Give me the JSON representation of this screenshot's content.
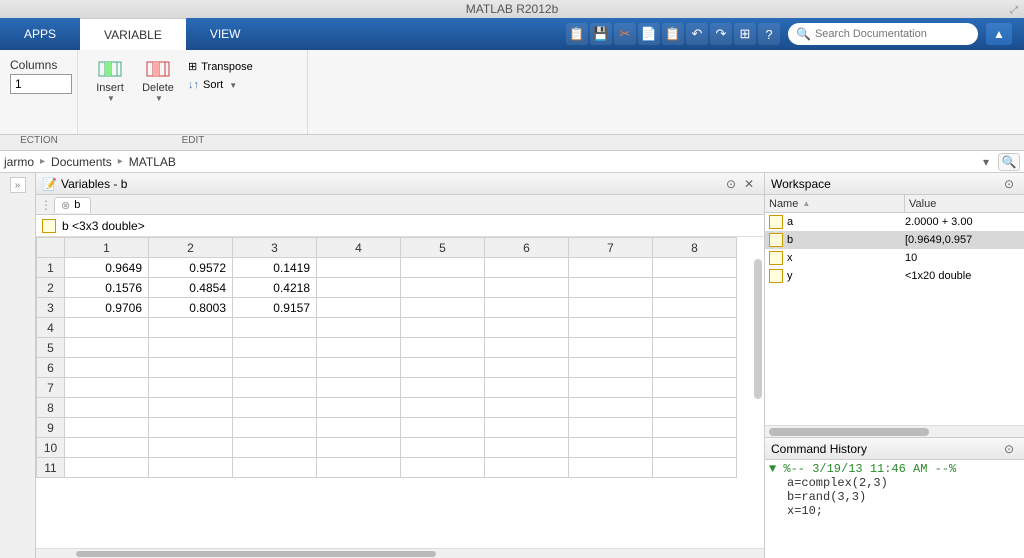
{
  "app": {
    "title": "MATLAB R2012b"
  },
  "ribbon": {
    "tabs": {
      "apps": "APPS",
      "variable": "VARIABLE",
      "view": "VIEW"
    },
    "columns_label": "Columns",
    "columns_value": "1",
    "insert": "Insert",
    "delete": "Delete",
    "transpose": "Transpose",
    "sort": "Sort",
    "group_selection": "ECTION",
    "group_edit": "EDIT"
  },
  "search": {
    "placeholder": "Search Documentation"
  },
  "path": {
    "seg1": "jarmo",
    "seg2": "Documents",
    "seg3": "MATLAB"
  },
  "variables_panel": {
    "title": "Variables - b",
    "tab_name": "b",
    "info": "b <3x3 double>",
    "col_heads": [
      "1",
      "2",
      "3",
      "4",
      "5",
      "6",
      "7",
      "8"
    ],
    "row_heads": [
      "1",
      "2",
      "3",
      "4",
      "5",
      "6",
      "7",
      "8",
      "9",
      "10",
      "11"
    ],
    "cells": [
      [
        "0.9649",
        "0.9572",
        "0.1419",
        "",
        "",
        "",
        "",
        ""
      ],
      [
        "0.1576",
        "0.4854",
        "0.4218",
        "",
        "",
        "",
        "",
        ""
      ],
      [
        "0.9706",
        "0.8003",
        "0.9157",
        "",
        "",
        "",
        "",
        ""
      ],
      [
        "",
        "",
        "",
        "",
        "",
        "",
        "",
        ""
      ],
      [
        "",
        "",
        "",
        "",
        "",
        "",
        "",
        ""
      ],
      [
        "",
        "",
        "",
        "",
        "",
        "",
        "",
        ""
      ],
      [
        "",
        "",
        "",
        "",
        "",
        "",
        "",
        ""
      ],
      [
        "",
        "",
        "",
        "",
        "",
        "",
        "",
        ""
      ],
      [
        "",
        "",
        "",
        "",
        "",
        "",
        "",
        ""
      ],
      [
        "",
        "",
        "",
        "",
        "",
        "",
        "",
        ""
      ],
      [
        "",
        "",
        "",
        "",
        "",
        "",
        "",
        ""
      ]
    ]
  },
  "workspace": {
    "title": "Workspace",
    "col_name": "Name",
    "col_value": "Value",
    "rows": [
      {
        "name": "a",
        "value": "2.0000 + 3.00",
        "selected": false
      },
      {
        "name": "b",
        "value": "[0.9649,0.957",
        "selected": true
      },
      {
        "name": "x",
        "value": "10",
        "selected": false
      },
      {
        "name": "y",
        "value": "<1x20 double",
        "selected": false
      }
    ]
  },
  "history": {
    "title": "Command History",
    "date_line": "%-- 3/19/13 11:46 AM --%",
    "lines": [
      "a=complex(2,3)",
      "b=rand(3,3)",
      "x=10;"
    ]
  }
}
